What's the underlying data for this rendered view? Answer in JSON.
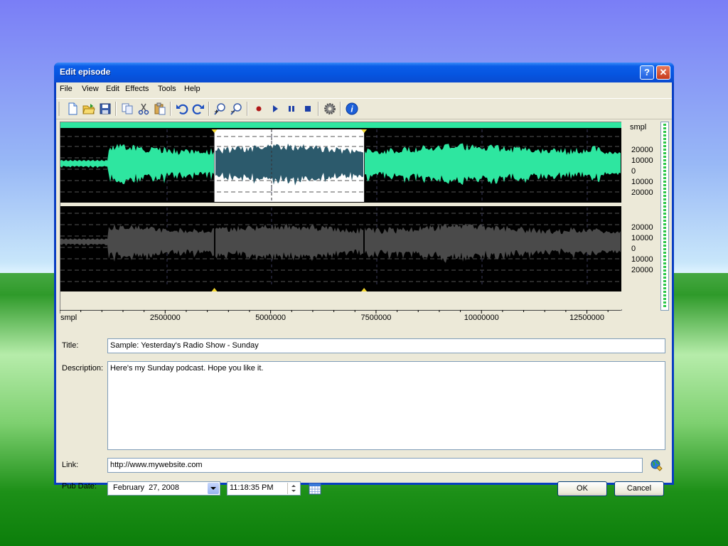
{
  "window": {
    "title": "Edit episode",
    "help_glyph": "?",
    "close_glyph": "✕"
  },
  "menu": [
    "File",
    "View",
    "Edit",
    "Effects",
    "Tools",
    "Help"
  ],
  "toolbar": {
    "icons": [
      "new-file-icon",
      "open-folder-icon",
      "save-icon",
      "copy-icon",
      "cut-icon",
      "paste-icon",
      "undo-icon",
      "redo-icon",
      "zoom-in-icon",
      "zoom-out-icon",
      "record-icon",
      "play-icon",
      "pause-icon",
      "stop-icon",
      "settings-gear-icon",
      "info-icon"
    ]
  },
  "waveform": {
    "y_unit": "smpl",
    "y_ticks": [
      "20000",
      "10000",
      "0",
      "10000",
      "20000"
    ],
    "x_unit": "smpl",
    "x_ticks": [
      "2500000",
      "5000000",
      "7500000",
      "10000000",
      "12500000"
    ],
    "selection_start": 3650000,
    "selection_end": 7200000,
    "total_samples": 13300000
  },
  "form": {
    "title_label": "Title:",
    "title_value": "Sample: Yesterday's Radio Show - Sunday",
    "description_label": "Description:",
    "description_value": "Here's my Sunday podcast. Hope you like it.",
    "link_label": "Link:",
    "link_value": "http://www.mywebsite.com",
    "pubdate_label": "Pub Date:",
    "date_value": "February  27, 2008",
    "time_value": "11:18:35 PM"
  },
  "buttons": {
    "ok": "OK",
    "cancel": "Cancel"
  },
  "colors": {
    "wave_top": "#2ee6a0",
    "wave_bottom": "#4a4a4a",
    "selection_wave": "#2c5a6c",
    "accent": "#0a4bd0"
  }
}
